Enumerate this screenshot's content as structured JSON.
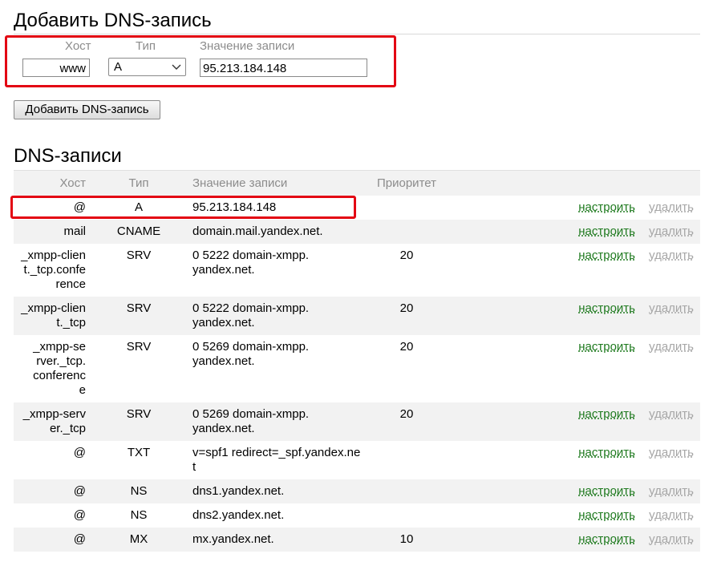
{
  "add_form": {
    "title": "Добавить DNS-запись",
    "host_label": "Хост",
    "type_label": "Тип",
    "value_label": "Значение записи",
    "host_value": "www",
    "type_value": "A",
    "value_value": "95.213.184.148",
    "submit_label": "Добавить DNS-запись"
  },
  "records": {
    "title": "DNS-записи",
    "headers": {
      "host": "Хост",
      "type": "Тип",
      "value": "Значение записи",
      "priority": "Приоритет"
    },
    "edit_label": "настроить",
    "delete_label": "удалить",
    "rows": [
      {
        "host": "@",
        "type": "A",
        "value": "95.213.184.148",
        "priority": ""
      },
      {
        "host": "mail",
        "type": "CNAME",
        "value": "domain.mail.yandex.net.",
        "priority": ""
      },
      {
        "host": "_xmpp-client._tcp.conference",
        "type": "SRV",
        "value": "0 5222 domain-xmpp.yandex.net.",
        "priority": "20"
      },
      {
        "host": "_xmpp-client._tcp",
        "type": "SRV",
        "value": "0 5222 domain-xmpp.yandex.net.",
        "priority": "20"
      },
      {
        "host": "_xmpp-server._tcp.conference",
        "type": "SRV",
        "value": "0 5269 domain-xmpp.yandex.net.",
        "priority": "20"
      },
      {
        "host": "_xmpp-server._tcp",
        "type": "SRV",
        "value": "0 5269 domain-xmpp.yandex.net.",
        "priority": "20"
      },
      {
        "host": "@",
        "type": "TXT",
        "value": "v=spf1 redirect=_spf.yandex.net",
        "priority": ""
      },
      {
        "host": "@",
        "type": "NS",
        "value": "dns1.yandex.net.",
        "priority": ""
      },
      {
        "host": "@",
        "type": "NS",
        "value": "dns2.yandex.net.",
        "priority": ""
      },
      {
        "host": "@",
        "type": "MX",
        "value": "mx.yandex.net.",
        "priority": "10"
      }
    ]
  },
  "colors": {
    "highlight": "#e30613",
    "link_green": "#1f7a1f",
    "link_gray": "#a6a6a6",
    "stripe": "#f2f2f2"
  }
}
